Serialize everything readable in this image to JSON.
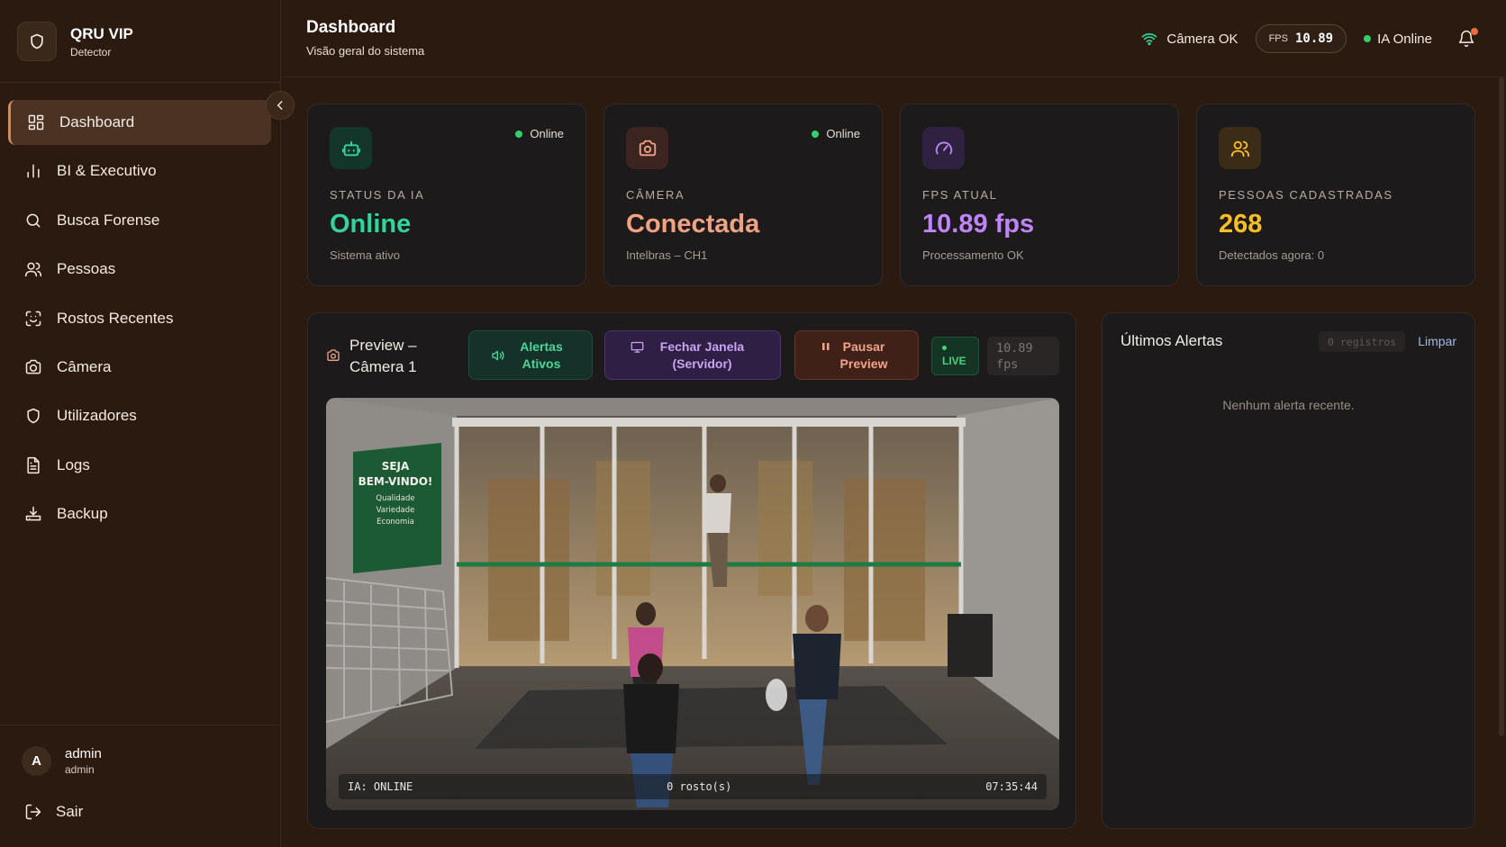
{
  "brand": {
    "title": "QRU VIP",
    "subtitle": "Detector"
  },
  "sidebar": {
    "items": [
      {
        "label": "Dashboard",
        "icon": "grid-icon",
        "active": true
      },
      {
        "label": "BI & Executivo",
        "icon": "bar-chart-icon"
      },
      {
        "label": "Busca Forense",
        "icon": "search-icon"
      },
      {
        "label": "Pessoas",
        "icon": "users-icon"
      },
      {
        "label": "Rostos Recentes",
        "icon": "face-scan-icon"
      },
      {
        "label": "Câmera",
        "icon": "camera-icon"
      },
      {
        "label": "Utilizadores",
        "icon": "shield-icon"
      },
      {
        "label": "Logs",
        "icon": "document-icon"
      },
      {
        "label": "Backup",
        "icon": "download-icon"
      }
    ],
    "user": {
      "initial": "A",
      "name": "admin",
      "role": "admin"
    },
    "logout_label": "Sair"
  },
  "header": {
    "title": "Dashboard",
    "subtitle": "Visão geral do sistema",
    "camera_status": "Câmera OK",
    "fps_label": "FPS",
    "fps_value": "10.89",
    "ia_status": "IA Online"
  },
  "cards": [
    {
      "label": "STATUS DA IA",
      "value": "Online",
      "sub": "Sistema ativo",
      "tag": "Online",
      "color": "#34d399",
      "icon": "robot-icon"
    },
    {
      "label": "CÂMERA",
      "value": "Conectada",
      "sub": "Intelbras – CH1",
      "tag": "Online",
      "color": "#f0a283",
      "icon": "camera-icon"
    },
    {
      "label": "FPS ATUAL",
      "value": "10.89 fps",
      "sub": "Processamento OK",
      "color": "#c084fc",
      "icon": "gauge-icon"
    },
    {
      "label": "PESSOAS CADASTRADAS",
      "value": "268",
      "sub": "Detectados agora: 0",
      "color": "#fbbf24",
      "icon": "users-icon"
    }
  ],
  "preview": {
    "title": "Preview – Câmera 1",
    "btn_alerts": "Alertas Ativos",
    "btn_close": "Fechar Janela (Servidor)",
    "btn_pause": "Pausar Preview",
    "live": "LIVE",
    "fps": "10.89 fps",
    "osd_left": "IA: ONLINE",
    "osd_center": "0 rosto(s)",
    "osd_right": "07:35:44",
    "sign": {
      "line1": "SEJA",
      "line2": "BEM-VINDO!",
      "line3": "Qualidade",
      "line4": "Variedade",
      "line5": "Economia"
    }
  },
  "alerts": {
    "title": "Últimos Alertas",
    "count": "0 registros",
    "clear_label": "Limpar",
    "empty": "Nenhum alerta recente."
  }
}
